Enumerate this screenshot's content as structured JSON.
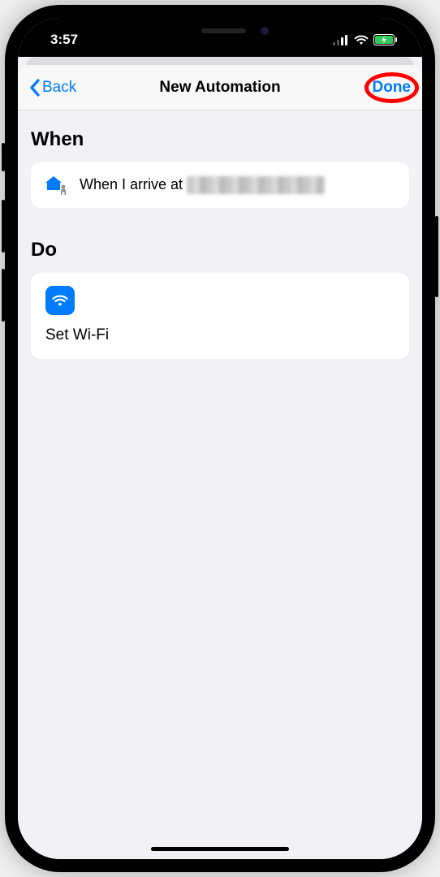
{
  "status": {
    "time": "3:57"
  },
  "nav": {
    "back_label": "Back",
    "title": "New Automation",
    "done_label": "Done"
  },
  "when": {
    "heading": "When",
    "text": "When I arrive at "
  },
  "do": {
    "heading": "Do",
    "action_label": "Set Wi-Fi"
  }
}
